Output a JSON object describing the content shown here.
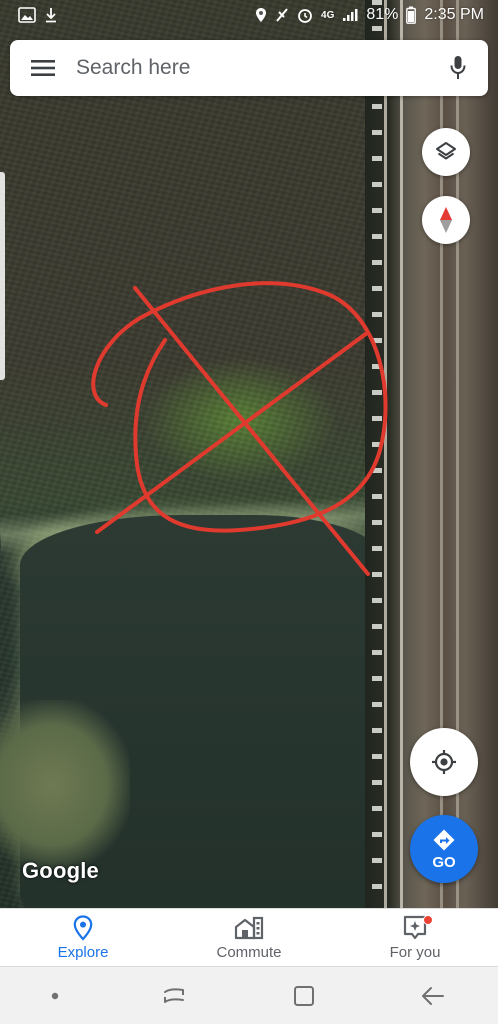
{
  "status_bar": {
    "time": "2:35 PM",
    "battery": "81%",
    "network": "4G",
    "left_icons": [
      "gallery-icon",
      "download-icon"
    ],
    "right_icons": [
      "location-icon",
      "nfc-icon",
      "alarm-icon",
      "signal-icon",
      "battery-icon"
    ]
  },
  "search": {
    "placeholder": "Search here",
    "menu_icon": "hamburger-menu-icon",
    "mic_icon": "microphone-icon"
  },
  "map": {
    "attribution": "Google",
    "view": "satellite",
    "annotation": "red-hand-drawn-circled-x",
    "controls": [
      "layers-icon",
      "compass-icon",
      "my-location-icon"
    ]
  },
  "go_button": {
    "label": "GO",
    "color": "#1a73e8"
  },
  "bottom_nav": {
    "tabs": [
      {
        "label": "Explore",
        "icon": "explore-pin-icon",
        "active": true
      },
      {
        "label": "Commute",
        "icon": "commute-icon",
        "active": false
      },
      {
        "label": "For you",
        "icon": "for-you-icon",
        "active": false,
        "badge": true
      }
    ]
  },
  "system_nav": {
    "buttons": [
      "recents-icon",
      "home-icon",
      "back-icon"
    ]
  },
  "colors": {
    "accent": "#1a73e8",
    "annotation": "#e03a2f",
    "badge": "#ea4335"
  }
}
